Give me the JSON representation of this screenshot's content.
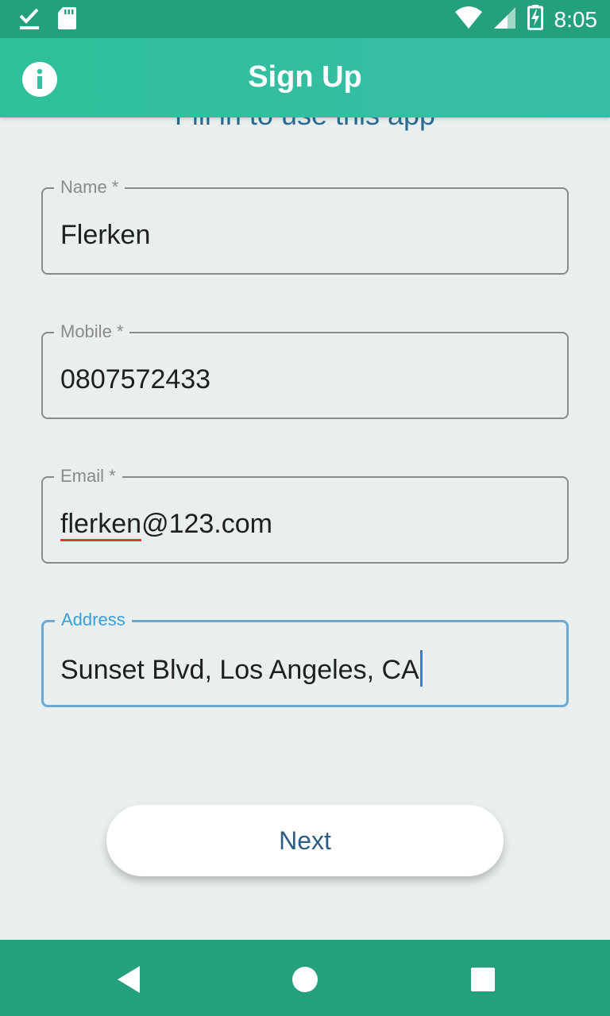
{
  "status_bar": {
    "time": "8:05",
    "icons": [
      "download-done-icon",
      "sd-card-icon",
      "wifi-icon",
      "cell-signal-icon",
      "battery-charging-icon"
    ]
  },
  "app_bar": {
    "title": "Sign Up",
    "info_icon": "info-icon"
  },
  "form": {
    "subtitle": "Fill in to use this app",
    "fields": [
      {
        "label": "Name *",
        "value": "Flerken"
      },
      {
        "label": "Mobile *",
        "value": "0807572433"
      },
      {
        "label": "Email *",
        "value_underlined": "flerken",
        "value_rest": "@123.com"
      },
      {
        "label": "Address",
        "value": "Sunset Blvd, Los Angeles, CA",
        "focused": true
      }
    ],
    "next_label": "Next"
  },
  "nav_bar": {
    "icons": [
      "back-icon",
      "home-icon",
      "recents-icon"
    ]
  },
  "colors": {
    "primary": "#24A07D",
    "app_bar": "#2EC09A",
    "background": "#E8EFEE",
    "focus": "#3C9ED9",
    "button_text": "#2D5C84"
  }
}
